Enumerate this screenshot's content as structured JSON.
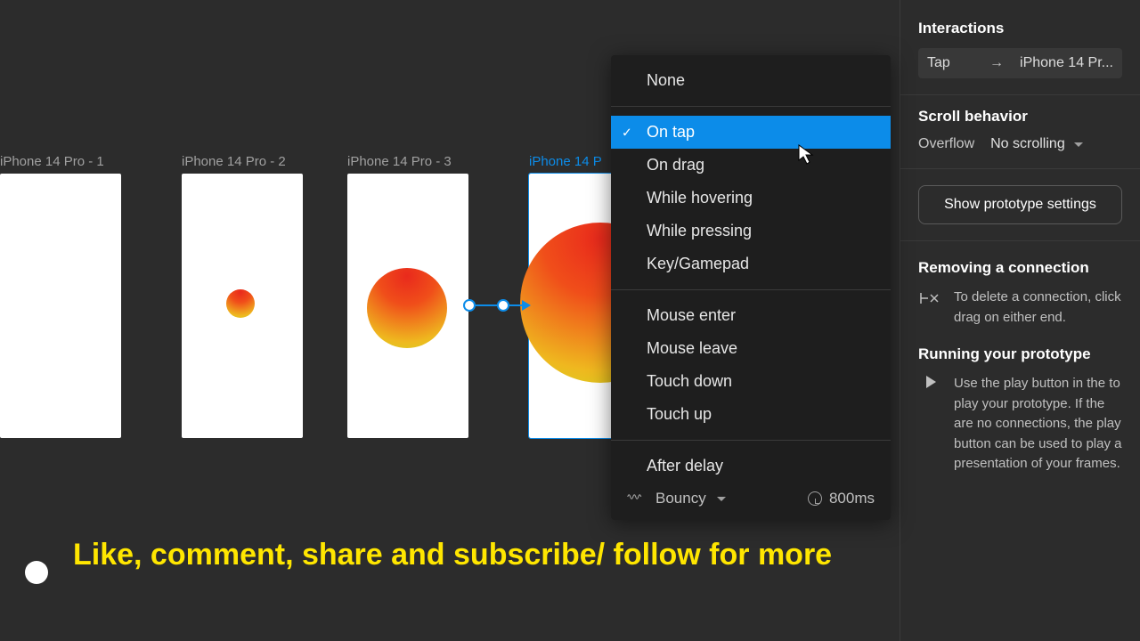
{
  "frames": [
    {
      "label": "iPhone 14 Pro - 1"
    },
    {
      "label": "iPhone 14 Pro - 2"
    },
    {
      "label": "iPhone 14 Pro - 3"
    },
    {
      "label": "iPhone 14 P"
    }
  ],
  "dropdown": {
    "items": [
      "None",
      "On tap",
      "On drag",
      "While hovering",
      "While pressing",
      "Key/Gamepad",
      "Mouse enter",
      "Mouse leave",
      "Touch down",
      "Touch up",
      "After delay"
    ],
    "selected": "On tap",
    "easing": "Bouncy",
    "duration": "800ms"
  },
  "panel": {
    "interactions": {
      "title": "Interactions",
      "trigger": "Tap",
      "target": "iPhone 14 Pr..."
    },
    "scroll": {
      "title": "Scroll behavior",
      "label": "Overflow",
      "value": "No scrolling"
    },
    "proto_button": "Show prototype settings",
    "help1": {
      "title": "Removing a connection",
      "body": "To delete a connection, click drag on either end."
    },
    "help2": {
      "title": "Running your prototype",
      "body": "Use the play button in the to play your prototype. If the are no connections, the play button can be used to play a presentation of your frames."
    }
  },
  "caption": "Like, comment, share and subscribe/ follow for more"
}
